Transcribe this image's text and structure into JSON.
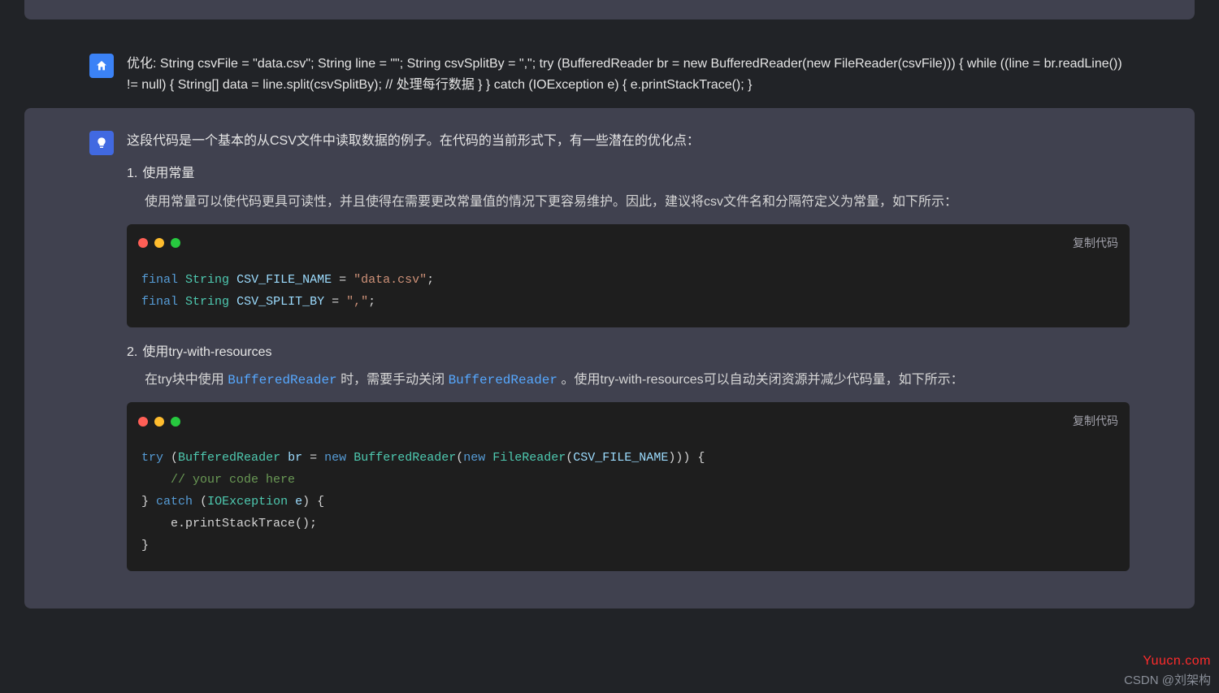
{
  "user_message": "优化: String csvFile = \"data.csv\"; String line = \"\"; String csvSplitBy = \",\"; try (BufferedReader br = new BufferedReader(new FileReader(csvFile))) { while ((line = br.readLine()) != null) { String[] data = line.split(csvSplitBy); // 处理每行数据 } } catch (IOException e) { e.printStackTrace(); }",
  "assistant": {
    "intro": "这段代码是一个基本的从CSV文件中读取数据的例子。在代码的当前形式下，有一些潜在的优化点：",
    "items": [
      {
        "title": "使用常量",
        "body_prefix": "使用常量可以使代码更具可读性，并且使得在需要更改常量值的情况下更容易维护。因此，建议将csv文件名和分隔符定义为常量，如下所示：",
        "code_fragments": {
          "l1_kw": "final",
          "l1_type": "String",
          "l1_var": "CSV_FILE_NAME",
          "l1_op": "=",
          "l1_str": "\"data.csv\"",
          "l2_kw": "final",
          "l2_type": "String",
          "l2_var": "CSV_SPLIT_BY",
          "l2_op": "=",
          "l2_str": "\",\""
        }
      },
      {
        "title": "使用try-with-resources",
        "body_parts": {
          "p1": "在try块中使用",
          "c1": "BufferedReader",
          "p2": "时，需要手动关闭",
          "c2": "BufferedReader",
          "p3": "。使用try-with-resources可以自动关闭资源并减少代码量，如下所示："
        },
        "code_fragments": {
          "try_kw": "try",
          "buf": "BufferedReader",
          "br": "br",
          "eq": "=",
          "new_kw": "new",
          "buf2": "BufferedReader",
          "new_kw2": "new",
          "fr": "FileReader",
          "arg": "CSV_FILE_NAME",
          "comment": "// your code here",
          "catch_kw": "catch",
          "ioe_type": "IOException",
          "ioe_var": "e",
          "print_expr": "e.printStackTrace();"
        }
      }
    ]
  },
  "copy_label": "复制代码",
  "watermark_site": "Yuucn.com",
  "watermark_author": "CSDN @刘架构"
}
